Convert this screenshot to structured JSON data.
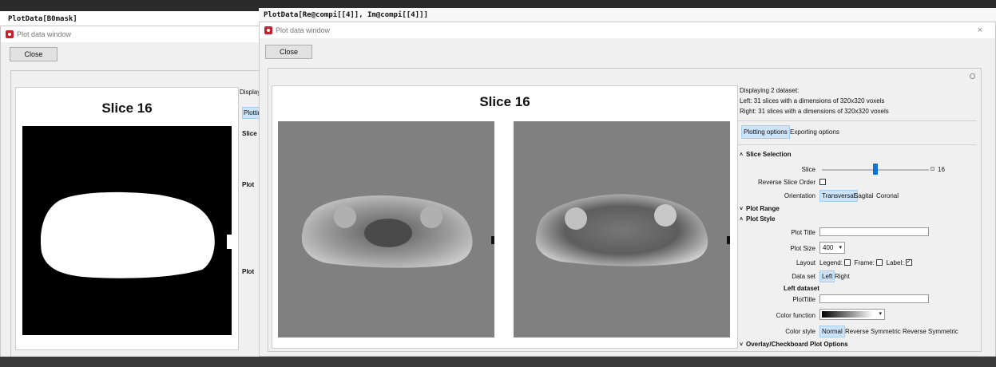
{
  "back_window": {
    "code": "PlotData[B0mask]",
    "title": "Plot data window",
    "close_label": "Close",
    "plot_title": "Slice 16",
    "side_fragments": [
      "Displaying",
      "Plotting",
      "Slice",
      "Plot",
      "Plot"
    ]
  },
  "main_window": {
    "code": "PlotData[Re@compi[[4]], Im@compi[[4]]]",
    "title": "Plot data window",
    "close_label": "Close",
    "close_x": "×",
    "plot_title": "Slice 16",
    "info": {
      "line1": "Displaying 2 dataset:",
      "line2": "Left: 31 slices with a dimensions of 320x320 voxels",
      "line3": "Right: 31 slices with a dimensions of 320x320 voxels"
    },
    "tabs": [
      "Plotting options",
      "Exporting options"
    ],
    "slice_selection": {
      "header": "Slice Selection",
      "slice_label": "Slice",
      "slice_value": "16",
      "slice_fraction": 0.5,
      "reverse_label": "Reverse Slice Order",
      "orientation_label": "Orientation",
      "orientations": [
        "Transversal",
        "Sagital",
        "Coronal"
      ]
    },
    "plot_range_header": "Plot Range",
    "plot_style": {
      "header": "Plot Style",
      "plot_title_label": "Plot Title",
      "plot_title_value": "",
      "plot_size_label": "Plot Size",
      "plot_size_value": "400",
      "layout_label": "Layout",
      "legend_label": "Legend:",
      "frame_label": "Frame:",
      "label_label": "Label:",
      "dataset_label": "Data set",
      "datasets": [
        "Left",
        "Right"
      ],
      "left_dataset_header": "Left dataset",
      "plottitle_label": "PlotTitle",
      "plottitle_value": "",
      "color_function_label": "Color function",
      "color_style_label": "Color style",
      "color_styles": [
        "Normal",
        "Reverse",
        "Symmetric",
        "Reverse Symmetric"
      ]
    },
    "overlay_header": "Overlay/Checkboard Plot Options"
  }
}
